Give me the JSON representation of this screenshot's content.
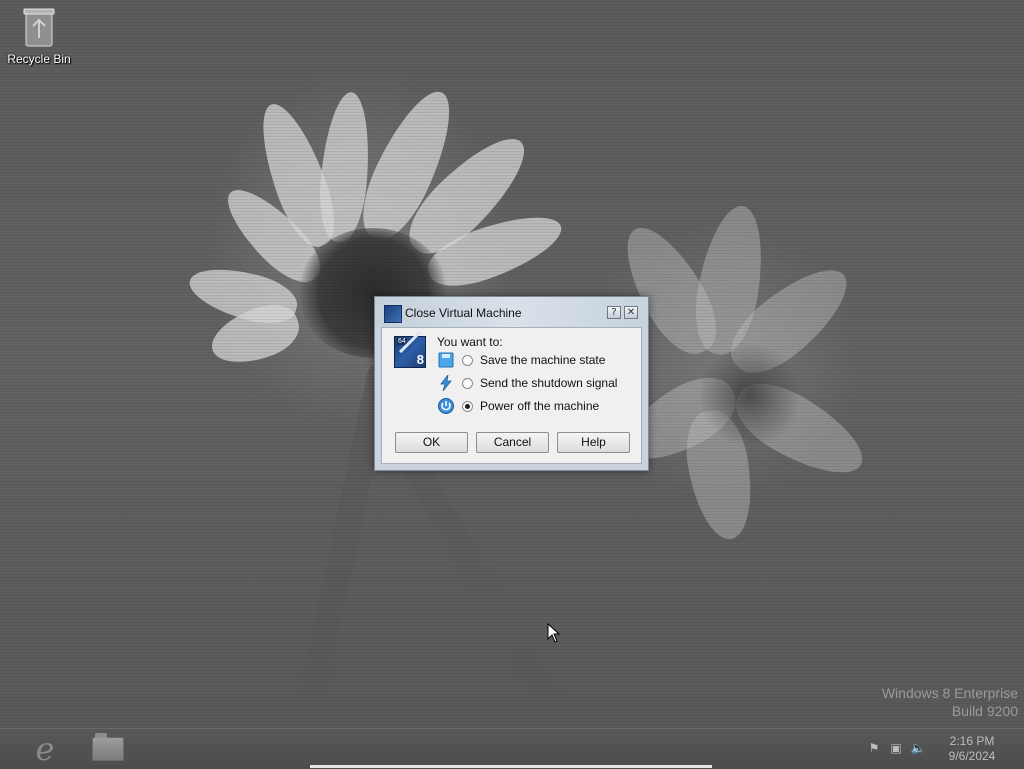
{
  "desktop": {
    "icons": [
      {
        "label": "Recycle Bin",
        "icon": "recycle-bin-icon"
      }
    ],
    "watermark": {
      "line1": "Windows 8 Enterprise",
      "line2": "Build 9200"
    }
  },
  "dialog": {
    "title": "Close Virtual Machine",
    "prompt": "You want to:",
    "options": [
      {
        "label": "Save the machine state",
        "icon": "save-state-icon",
        "selected": false
      },
      {
        "label": "Send the shutdown signal",
        "icon": "lightning-icon",
        "selected": false
      },
      {
        "label": "Power off the machine",
        "icon": "power-icon",
        "selected": true
      }
    ],
    "buttons": {
      "ok": "OK",
      "cancel": "Cancel",
      "help": "Help"
    },
    "titlebar_buttons": {
      "help": "?",
      "close": "✕"
    }
  },
  "taskbar": {
    "apps": [
      {
        "name": "Internet Explorer",
        "icon": "internet-explorer-icon"
      },
      {
        "name": "File Explorer",
        "icon": "folder-icon"
      }
    ],
    "tray": {
      "time": "2:16 PM",
      "date": "9/6/2024"
    }
  }
}
